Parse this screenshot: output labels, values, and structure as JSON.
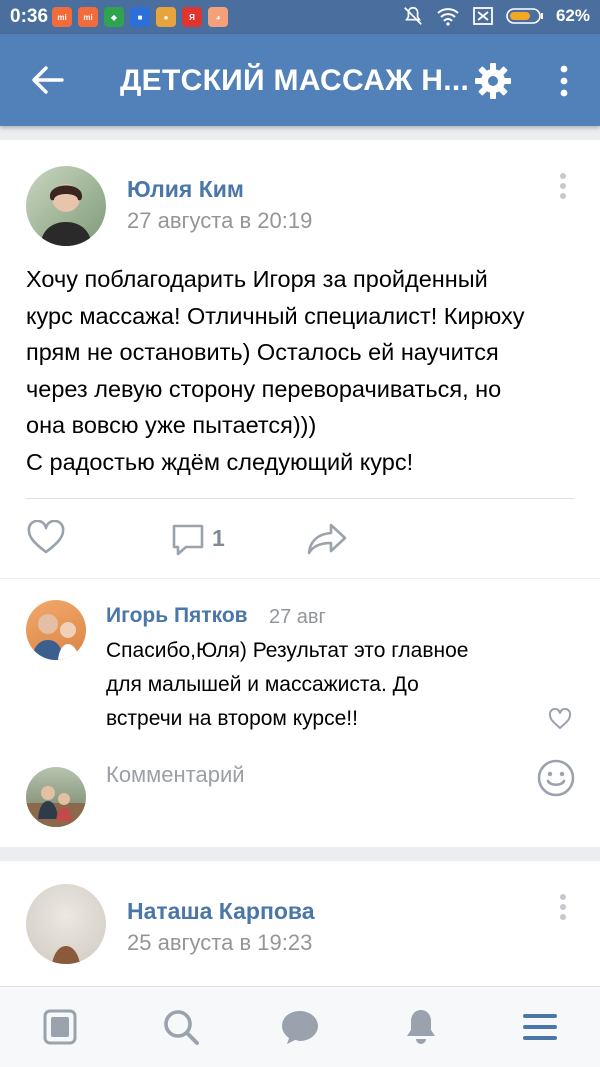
{
  "status_bar": {
    "time": "0:36",
    "battery": "62%",
    "app_icons": [
      "xiaomi-life-icon",
      "xiaomi-life-icon",
      "shield-icon",
      "flag-icon",
      "game-icon",
      "yandex-icon",
      "cat-icon"
    ]
  },
  "app_bar": {
    "title": "ДЕТСКИЙ МАССАЖ Н...",
    "icons": [
      "back-arrow-icon",
      "gear-icon",
      "more-vert-icon"
    ]
  },
  "post": {
    "author": "Юлия Ким",
    "date": "27 августа в 20:19",
    "text": "Хочу поблагодарить Игоря за пройденный\nкурс массажа! Отличный специалист! Кирюху\nпрям не остановить) Осталось ей научится\nчерез левую сторону переворачиваться, но\nона вовсю уже пытается)))\nС радостью ждём следующий курс!",
    "comments_count": "1"
  },
  "comment": {
    "author": "Игорь Пятков",
    "date": "27 авг",
    "text": "Спасибо,Юля) Результат это главное\nдля малышей и массажиста. До\nвстречи на втором курсе!!"
  },
  "comment_input": {
    "placeholder": "Комментарий",
    "value": ""
  },
  "next_post": {
    "author": "Наташа Карпова",
    "date": "25 августа в 19:23"
  },
  "tab_bar": {
    "tabs": [
      "news-icon",
      "search-icon",
      "messages-icon",
      "notifications-icon",
      "menu-icon"
    ],
    "active_tab": "menu-icon"
  },
  "colors": {
    "header": "#5181b8",
    "status_bar": "#4a6f9e",
    "link": "#4a76a8",
    "icon_gray": "#99a2ad",
    "active_tab": "#4a76a8"
  }
}
